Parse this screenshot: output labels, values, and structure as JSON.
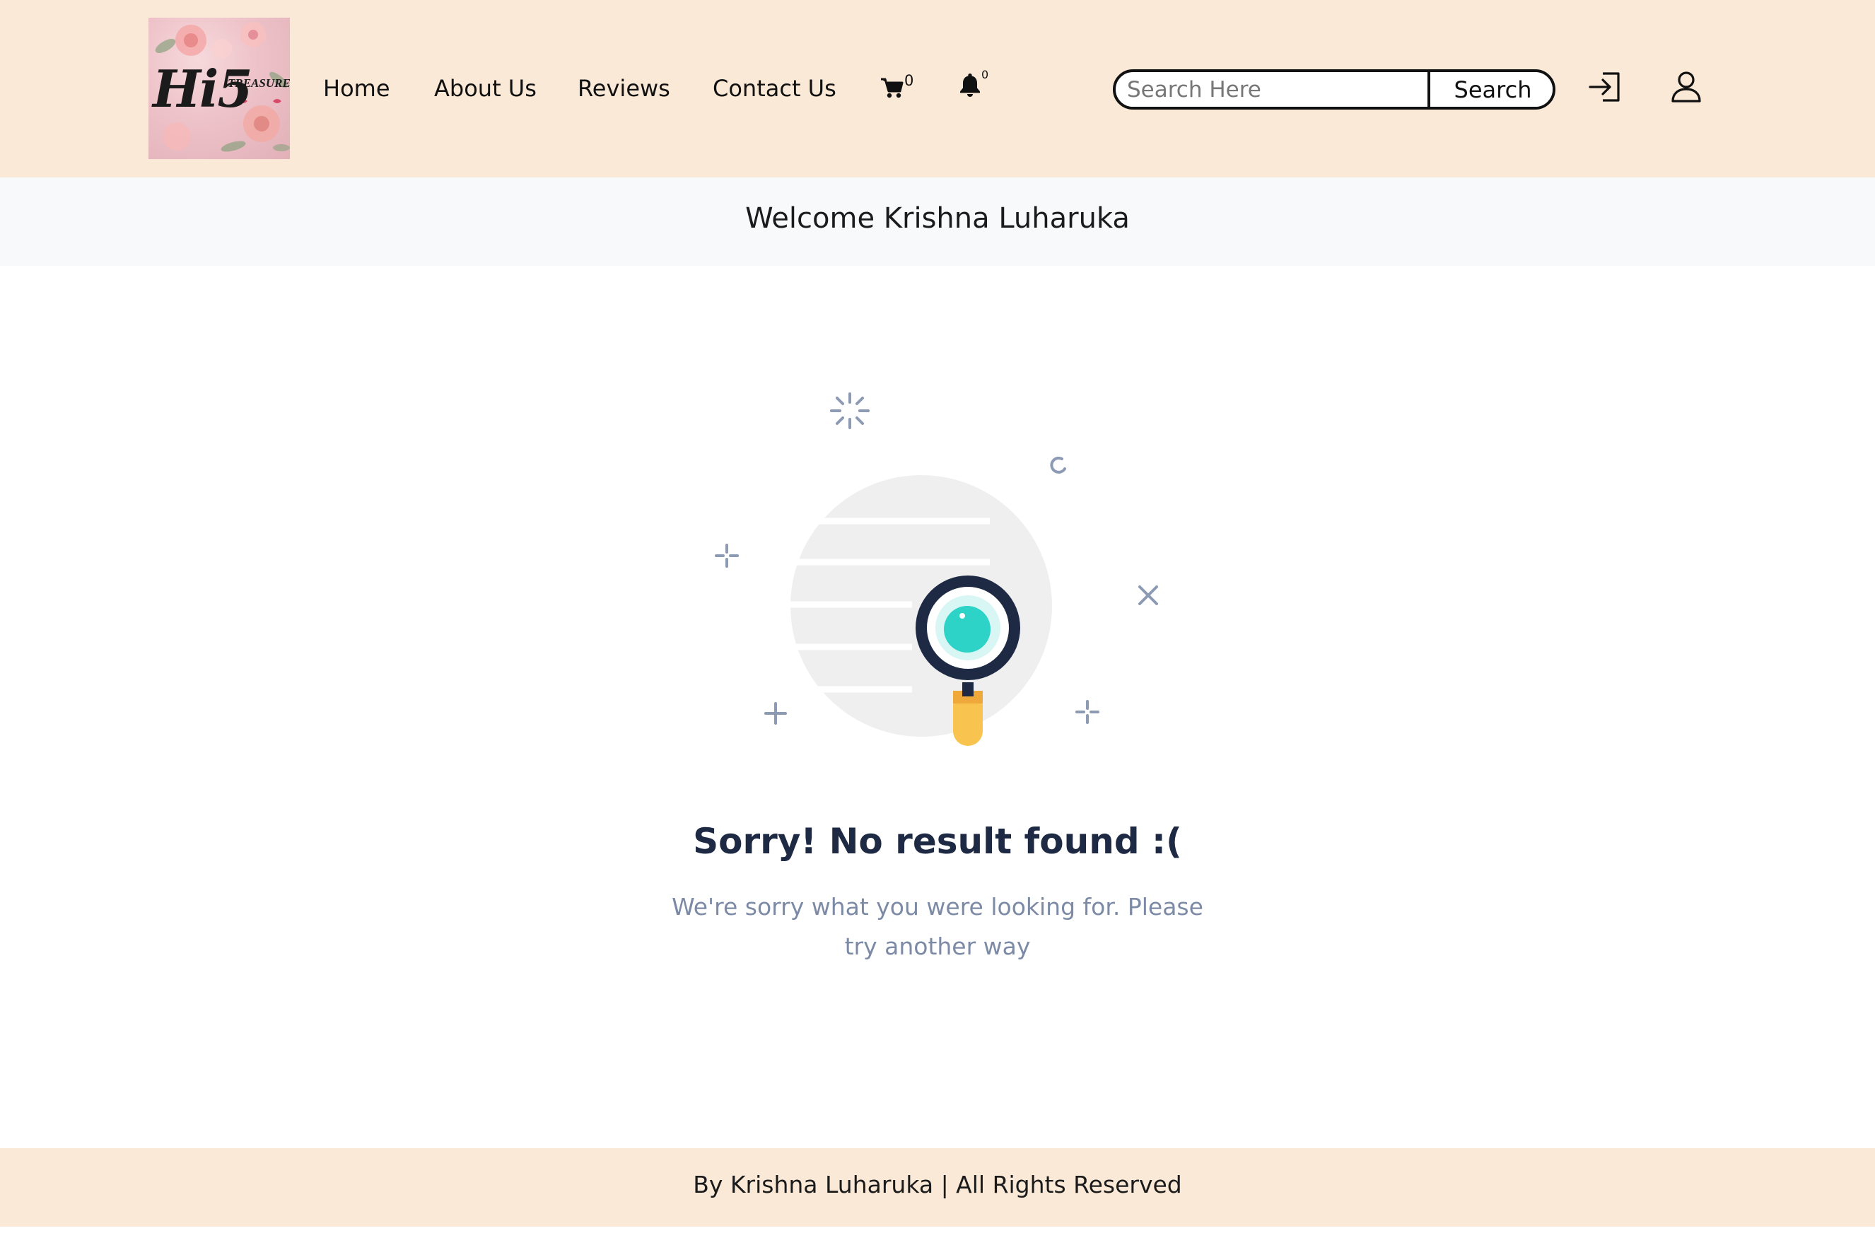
{
  "header": {
    "logo": {
      "word": "Hi5",
      "tagline": "TREASURES"
    },
    "nav": {
      "home": "Home",
      "about": "About Us",
      "reviews": "Reviews",
      "contact": "Contact Us"
    },
    "cart_count": "0",
    "notification_count": "0",
    "search": {
      "placeholder": "Search Here",
      "button_label": "Search"
    },
    "icons": {
      "cart": "cart-icon",
      "bell": "bell-icon",
      "login": "login-icon",
      "user": "user-icon"
    }
  },
  "welcome": {
    "text": "Welcome Krishna Luharuka"
  },
  "empty_state": {
    "title": "Sorry! No result found :(",
    "subtitle": "We're sorry what you were looking for. Please try another way",
    "illustration": "magnifying-glass-illustration"
  },
  "footer": {
    "text": "By Krishna Luharuka | All Rights Reserved"
  },
  "colors": {
    "header_bg": "#fae9d6",
    "welcome_bg": "#f8f9fb",
    "title": "#1e2a44",
    "subtitle": "#7c8aa5",
    "accent_teal": "#2ed3c8",
    "accent_yellow": "#f8c44f"
  }
}
